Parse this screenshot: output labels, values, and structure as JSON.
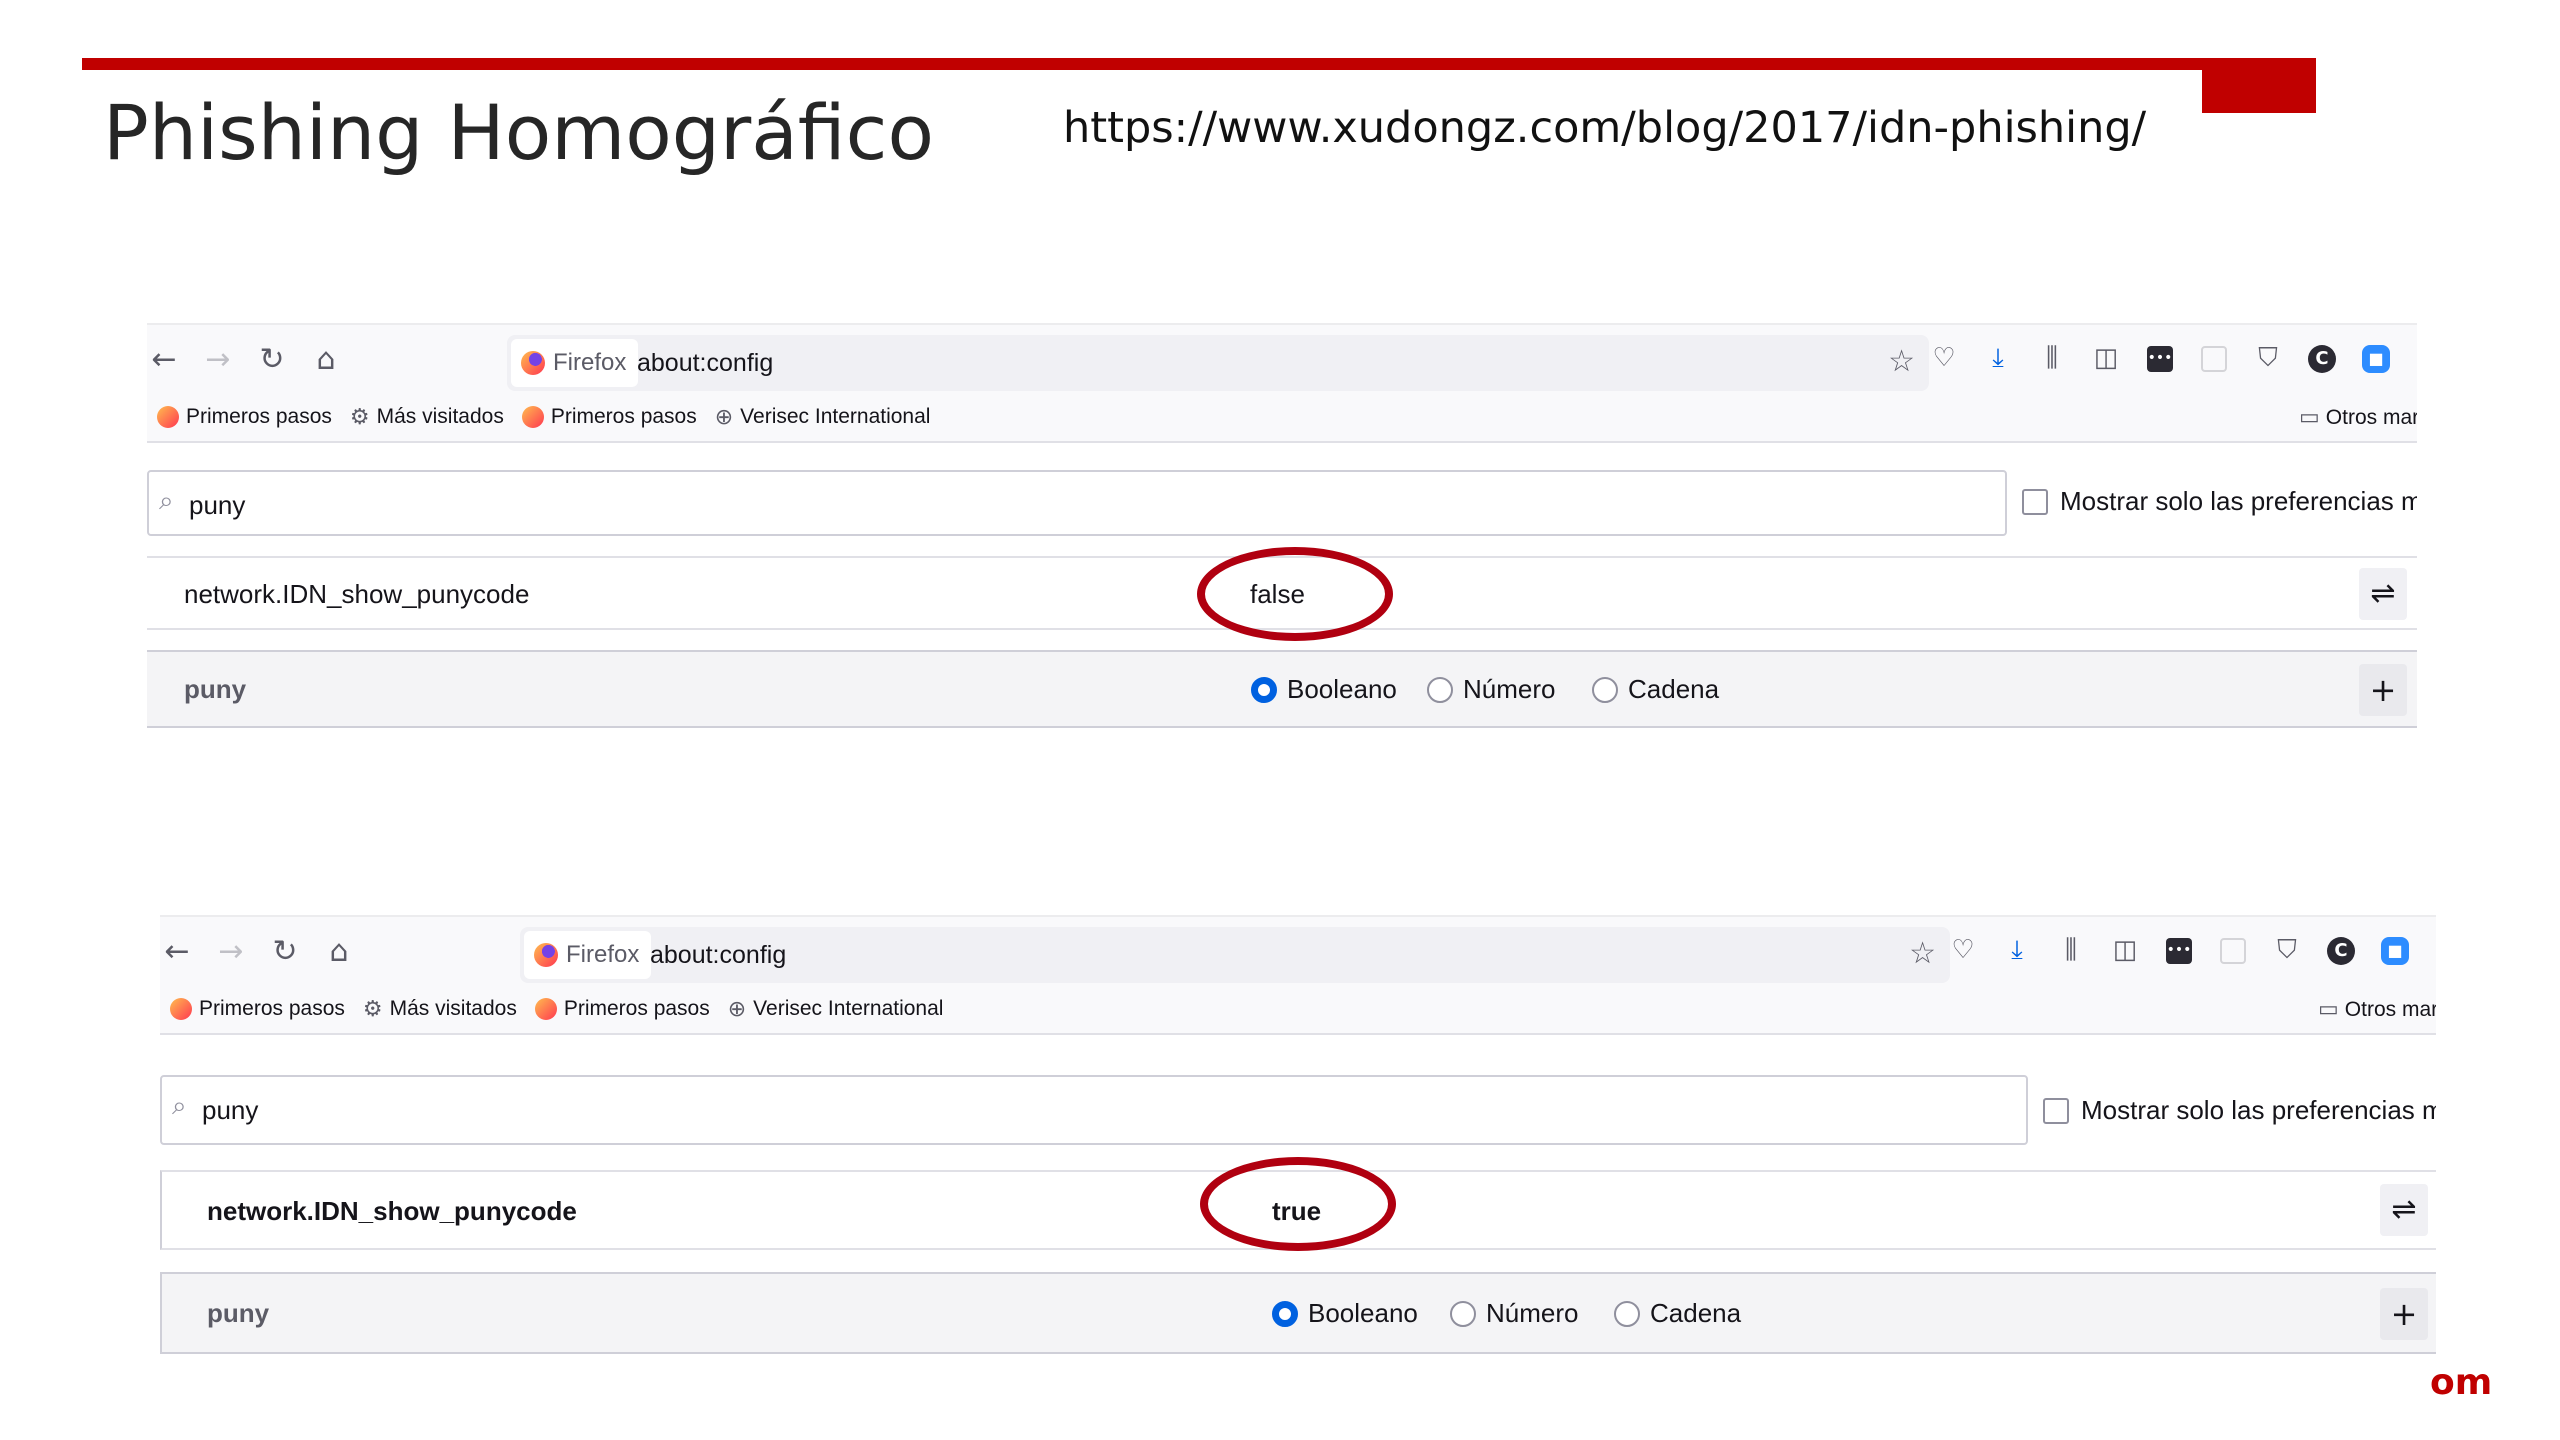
{
  "slide": {
    "title": "Phishing Homográfico",
    "source_url": "https://www.xudongz.com/blog/2017/idn-phishing/",
    "corner_text": "om",
    "accent_color": "#c00000"
  },
  "screenshots": [
    {
      "browser": {
        "identity_label": "Firefox",
        "address": "about:config"
      },
      "bookmarks": {
        "items": [
          "Primeros pasos",
          "Más visitados",
          "Primeros pasos",
          "Verisec International"
        ],
        "other": "Otros marca"
      },
      "search": {
        "value": "puny",
        "modified_only_label": "Mostrar solo las preferencias modifi",
        "modified_only_checked": false
      },
      "preference": {
        "name": "network.IDN_show_punycode",
        "value": "false",
        "value_circled": true
      },
      "add_row": {
        "name": "puny",
        "types": [
          "Booleano",
          "Número",
          "Cadena"
        ],
        "selected_type": "Booleano"
      }
    },
    {
      "browser": {
        "identity_label": "Firefox",
        "address": "about:config"
      },
      "bookmarks": {
        "items": [
          "Primeros pasos",
          "Más visitados",
          "Primeros pasos",
          "Verisec International"
        ],
        "other": "Otros marca"
      },
      "search": {
        "value": "puny",
        "modified_only_label": "Mostrar solo las preferencias modific",
        "modified_only_checked": false
      },
      "preference": {
        "name": "network.IDN_show_punycode",
        "value": "true",
        "value_circled": true
      },
      "add_row": {
        "name": "puny",
        "types": [
          "Booleano",
          "Número",
          "Cadena"
        ],
        "selected_type": "Booleano"
      }
    }
  ]
}
